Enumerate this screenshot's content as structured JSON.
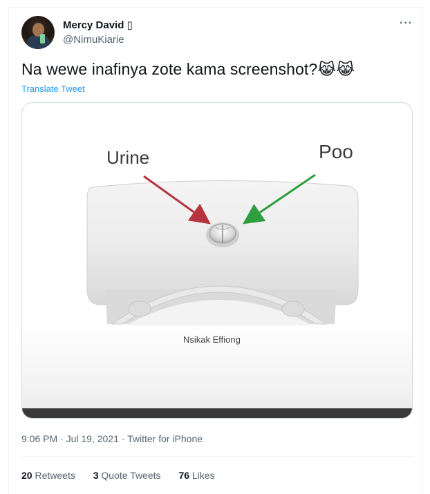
{
  "author": {
    "name": "Mercy David ▯",
    "handle": "@NimuKiarie"
  },
  "more_icon": "···",
  "tweet": {
    "text": "Na wewe inafinya zote kama screenshot?",
    "emoji": "😹😹",
    "translate_label": "Translate Tweet"
  },
  "media": {
    "label_left": "Urine",
    "label_right": "Poo",
    "watermark": "Nsikak Effiong",
    "arrow_left_color": "#b5343e",
    "arrow_right_color": "#2f9e3e"
  },
  "meta": {
    "time": "9:06 PM",
    "date": "Jul 19, 2021",
    "source": "Twitter for iPhone"
  },
  "stats": {
    "retweets_count": "20",
    "retweets_label": "Retweets",
    "quotes_count": "3",
    "quotes_label": "Quote Tweets",
    "likes_count": "76",
    "likes_label": "Likes"
  }
}
